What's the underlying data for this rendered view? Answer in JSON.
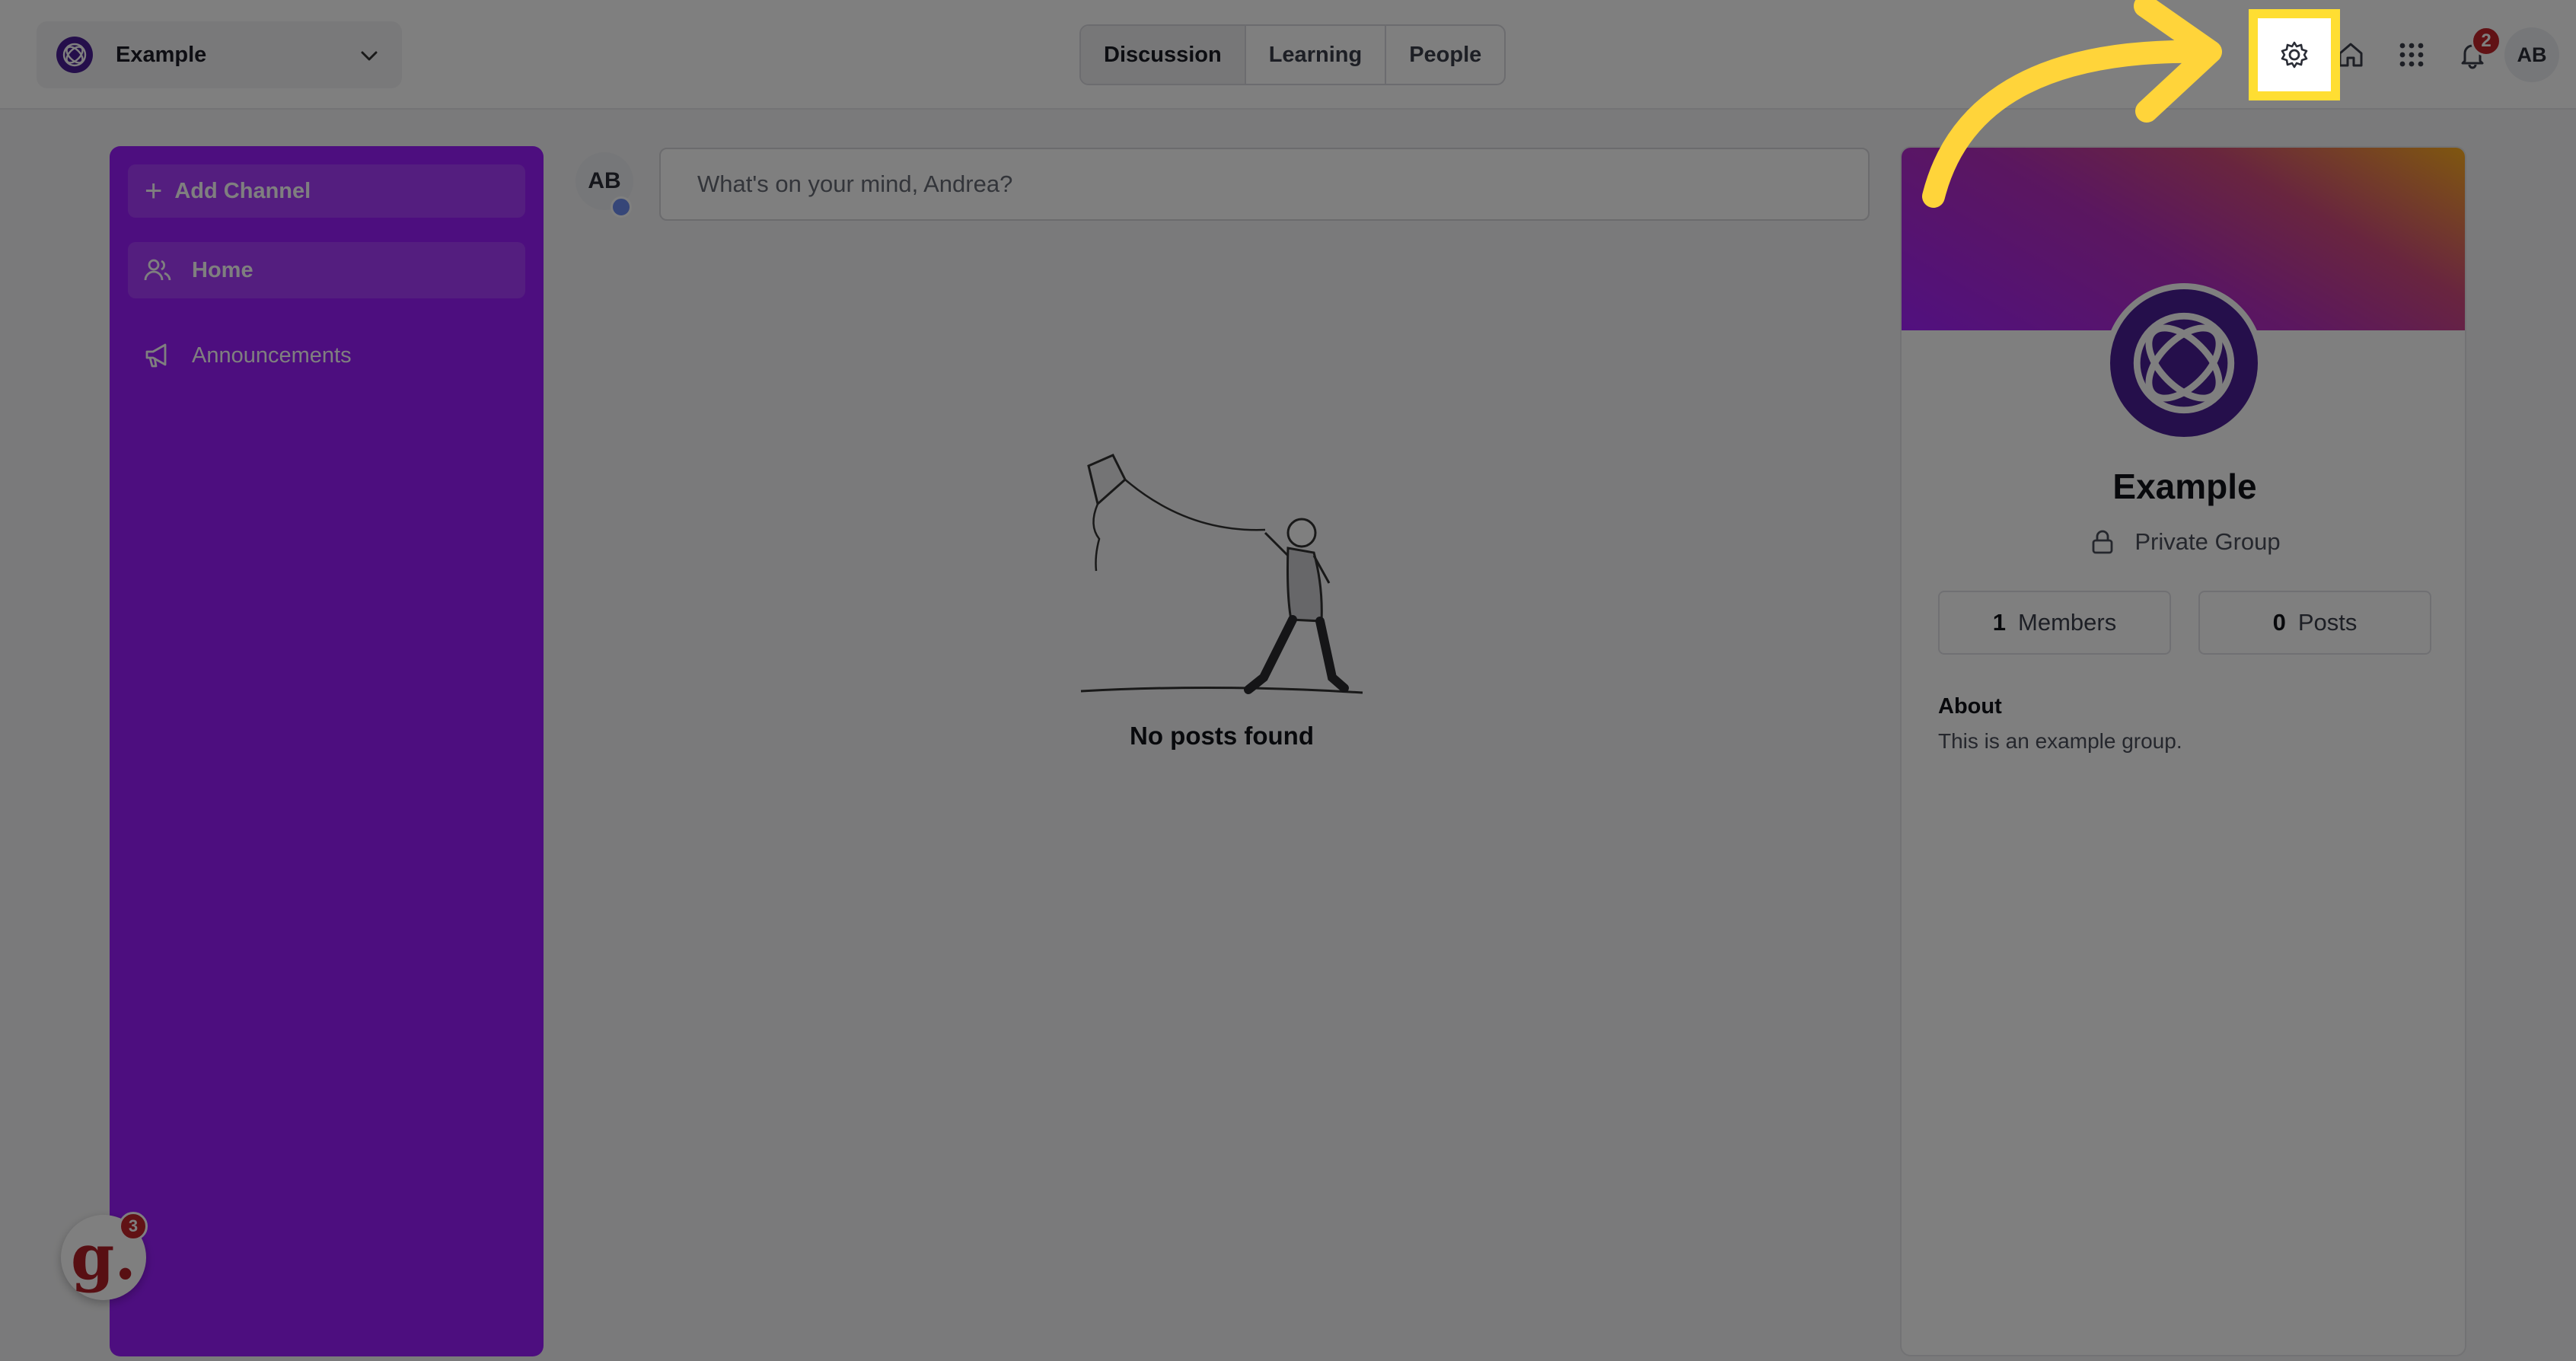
{
  "header": {
    "group_name": "Example",
    "tabs": [
      {
        "label": "Discussion",
        "active": true
      },
      {
        "label": "Learning",
        "active": false
      },
      {
        "label": "People",
        "active": false
      }
    ],
    "notifications_count": "2",
    "user_initials": "AB"
  },
  "sidebar": {
    "add_channel_label": "Add Channel",
    "items": [
      {
        "label": "Home",
        "icon": "users-icon",
        "active": true
      },
      {
        "label": "Announcements",
        "icon": "megaphone-icon",
        "active": false
      }
    ]
  },
  "feed": {
    "composer_avatar": "AB",
    "composer_placeholder": "What's on your mind, Andrea?",
    "empty_message": "No posts found"
  },
  "group_card": {
    "title": "Example",
    "privacy": "Private Group",
    "members_count": "1",
    "members_label": "Members",
    "posts_count": "0",
    "posts_label": "Posts",
    "about_title": "About",
    "about_text": "This is an example group."
  },
  "widget": {
    "letter": "g.",
    "badge": "3"
  },
  "colors": {
    "sidebar": "#9b1dff",
    "sidebar_active": "#a83dff",
    "brand_logo": "#4b1f96",
    "highlight": "#ffde32",
    "badge": "#c2242b"
  }
}
